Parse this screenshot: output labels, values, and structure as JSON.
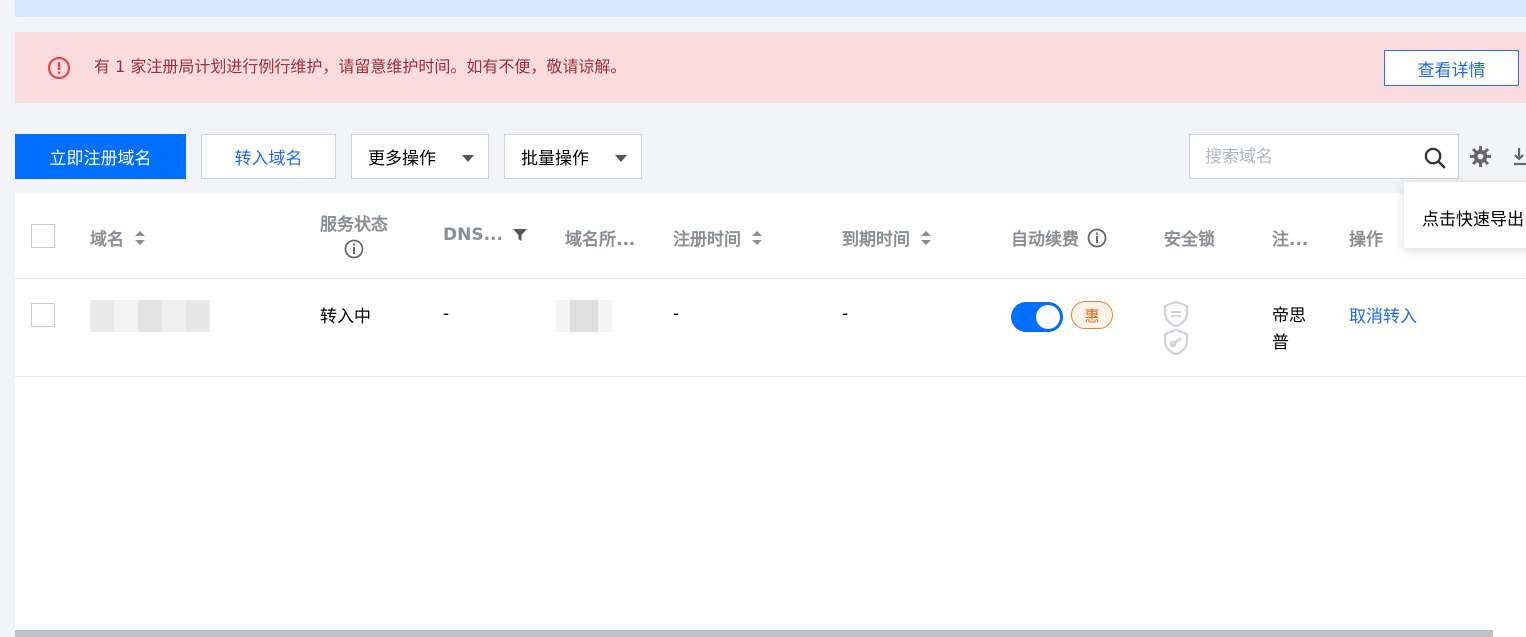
{
  "alert": {
    "message": "有 1 家注册局计划进行例行维护，请留意维护时间。如有不便，敬请谅解。",
    "details_label": "查看详情"
  },
  "toolbar": {
    "register_label": "立即注册域名",
    "transfer_label": "转入域名",
    "more_label": "更多操作",
    "batch_label": "批量操作"
  },
  "search": {
    "placeholder": "搜索域名"
  },
  "table": {
    "headers": {
      "domain": "域名",
      "service_status_line1": "服务状态",
      "dns": "DNS...",
      "domain_owner": "域名所...",
      "register_time": "注册时间",
      "expire_time": "到期时间",
      "auto_renew": "自动续费",
      "security_lock": "安全锁",
      "registrar": "注...",
      "actions": "操作"
    },
    "rows": [
      {
        "status": "转入中",
        "dns": "-",
        "register_time": "-",
        "expire_time": "-",
        "auto_renew_on": true,
        "promo_badge": "惠",
        "registrar_line1": "帝思",
        "registrar_line2": "普",
        "action": "取消转入"
      }
    ]
  },
  "tooltip": {
    "text": "点击快速导出"
  },
  "colors": {
    "primary": "#006eff",
    "link": "#1f6bed",
    "alert_bg": "#fadcdf",
    "alert_text": "#9d2f37"
  }
}
